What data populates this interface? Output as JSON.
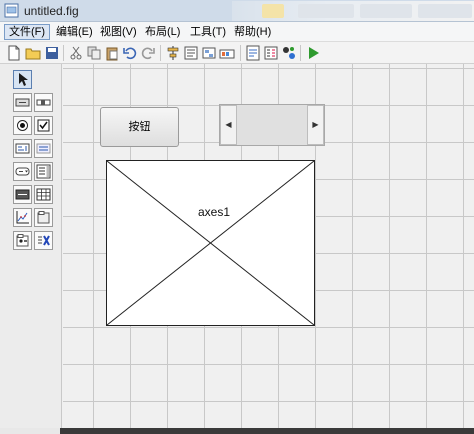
{
  "window": {
    "title": "untitled.fig"
  },
  "menu": {
    "items": [
      {
        "label": "文件(F)"
      },
      {
        "label": "编辑(E)"
      },
      {
        "label": "视图(V)"
      },
      {
        "label": "布局(L)"
      },
      {
        "label": "工具(T)"
      },
      {
        "label": "帮助(H)"
      }
    ]
  },
  "toolbar": {
    "icons": [
      "new-file-icon",
      "open-folder-icon",
      "cut-icon",
      "copy-icon",
      "paste-icon",
      "undo-icon",
      "redo-icon",
      "align-icon",
      "menu-editor-icon",
      "tab-order-icon",
      "toolbar-editor-icon",
      "mfile-editor-icon",
      "property-inspector-icon",
      "object-browser-icon",
      "run-icon"
    ]
  },
  "palette": {
    "tools": [
      "select-tool",
      "push-button-tool",
      "slider-tool",
      "radio-button-tool",
      "checkbox-tool",
      "edit-text-tool",
      "static-text-tool",
      "popup-menu-tool",
      "listbox-tool",
      "toggle-button-tool",
      "table-tool",
      "axes-tool",
      "panel-tool",
      "button-group-tool",
      "activex-tool"
    ]
  },
  "canvas": {
    "push_button": {
      "label": "按钮"
    },
    "axes": {
      "label": "axes1"
    }
  },
  "colors": {
    "run_green": "#2e9a2e",
    "titlebar": "#cfdbe9",
    "grid": "#c8c8c8"
  }
}
